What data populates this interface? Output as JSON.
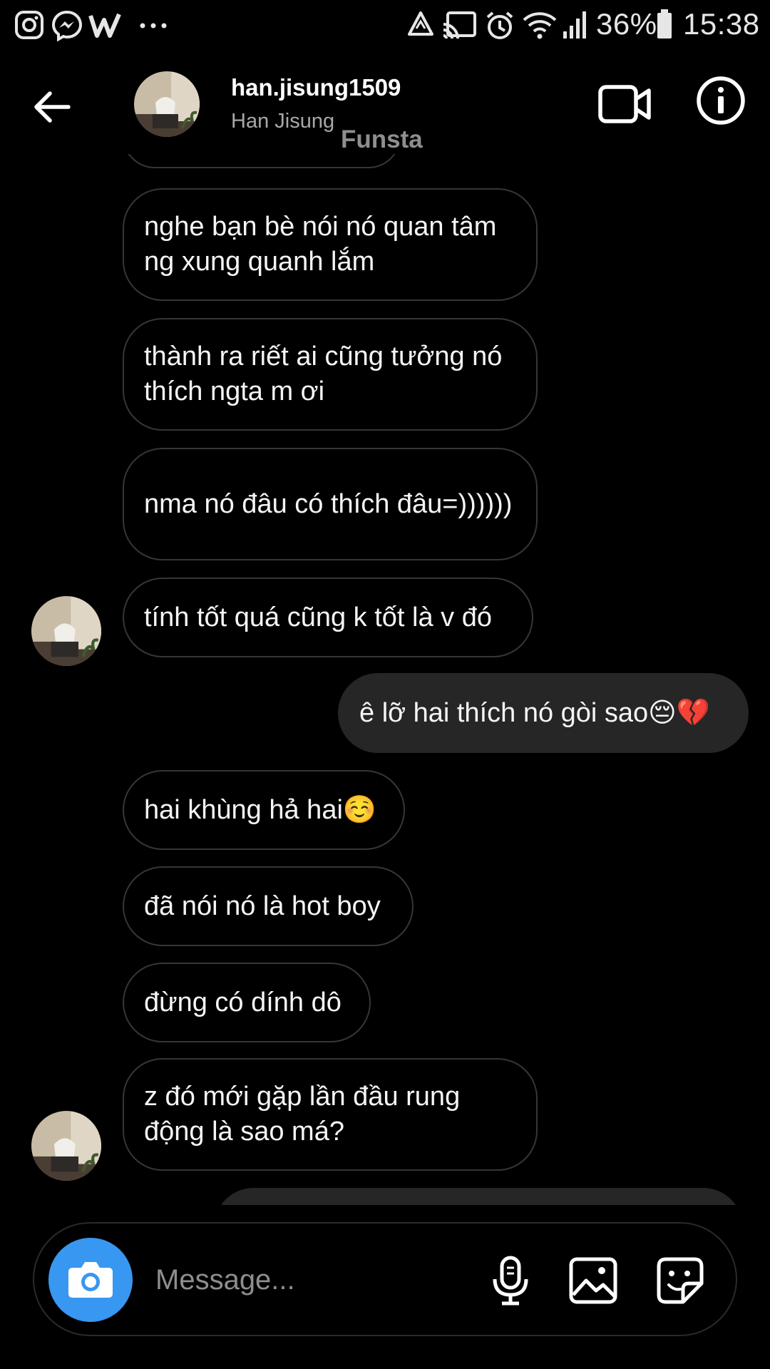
{
  "status_bar": {
    "left_icons": [
      "instagram-icon",
      "messenger-icon",
      "w-app-icon",
      "more-dots-icon"
    ],
    "right_icons": [
      "recycle-icon",
      "cast-icon",
      "alarm-icon",
      "wifi-icon",
      "signal-icon",
      "battery-icon"
    ],
    "battery": "36%",
    "time": "15:38"
  },
  "header": {
    "username": "han.jisung1509",
    "full_name": "Han Jisung",
    "tag": "Funsta",
    "icons": [
      "back-arrow-icon",
      "video-camera-icon",
      "info-icon"
    ]
  },
  "messages": [
    {
      "direction": "incoming",
      "text": "nghe bạn bè nói nó quan tâm ng xung quanh lắm",
      "avatar": false
    },
    {
      "direction": "incoming",
      "text": "thành ra riết ai cũng tưởng nó thích ngta m ơi",
      "avatar": false
    },
    {
      "direction": "incoming",
      "text": "nma nó đâu có thích đâu=))))))",
      "avatar": false
    },
    {
      "direction": "incoming",
      "text": "tính tốt quá cũng k tốt là v đó",
      "avatar": true
    },
    {
      "direction": "outgoing",
      "text": "ê lỡ hai thích nó gòi sao😔💔",
      "avatar": false
    },
    {
      "direction": "incoming",
      "text": "hai khùng hả hai☺️",
      "avatar": false
    },
    {
      "direction": "incoming",
      "text": "đã nói nó là hot boy",
      "avatar": false
    },
    {
      "direction": "incoming",
      "text": "đừng có dính dô",
      "avatar": false
    },
    {
      "direction": "incoming",
      "text": "z đó mới gặp lần đầu rung động là sao má?",
      "avatar": true
    }
  ],
  "composer": {
    "placeholder": "Message...",
    "icons": [
      "camera-icon",
      "microphone-icon",
      "gallery-icon",
      "sticker-icon"
    ],
    "accent": "#3897f0"
  },
  "colors": {
    "background": "#000000",
    "incoming_border": "#363636",
    "outgoing_fill": "#262626"
  }
}
